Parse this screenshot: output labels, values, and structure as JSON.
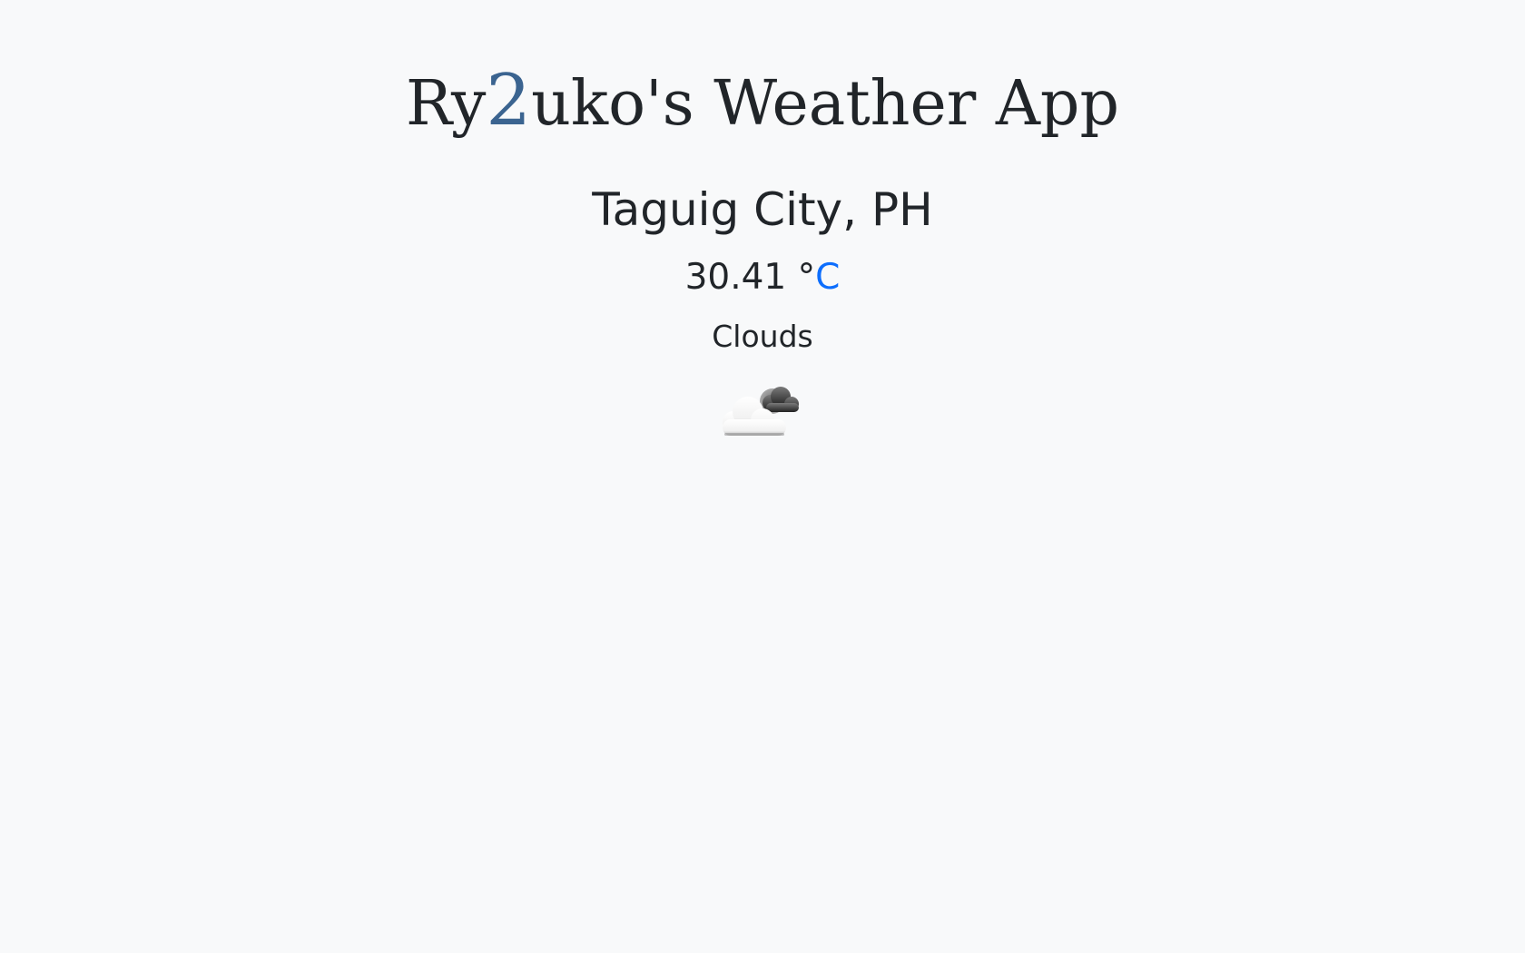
{
  "header": {
    "title_prefix": "Ry",
    "title_accent": "2",
    "title_suffix": "uko's Weather App",
    "accent_color": "#3b6490"
  },
  "weather": {
    "location": "Taguig City, PH",
    "temperature": "30.41",
    "unit_symbol": "°",
    "unit_letter": "C",
    "unit_color": "#0d6efd",
    "condition": "Clouds",
    "icon": "clouds-icon"
  }
}
